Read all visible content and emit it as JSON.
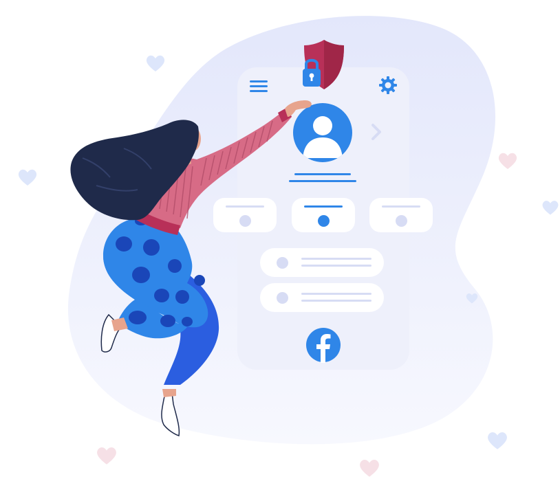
{
  "illustration": {
    "title": "",
    "colors": {
      "accent": "#2f86e8",
      "shield": "#b83058",
      "sweater": "#d76b86",
      "pants": "#2d6fe2",
      "hair": "#1f2a4a",
      "blob": "#e8ebfb",
      "card": "#eef0fb",
      "placeholder": "#d7dcf4"
    }
  },
  "phone": {
    "menu_icon": "hamburger-menu-icon",
    "settings_icon": "gear-icon",
    "next_icon": "chevron-right-icon",
    "profile_icon": "user-avatar-icon",
    "security_icon": "shield-lock-icon",
    "social_icon": "facebook-icon",
    "tabs": [
      {
        "state": "inactive"
      },
      {
        "state": "active"
      },
      {
        "state": "inactive"
      }
    ],
    "list_items": 2
  }
}
